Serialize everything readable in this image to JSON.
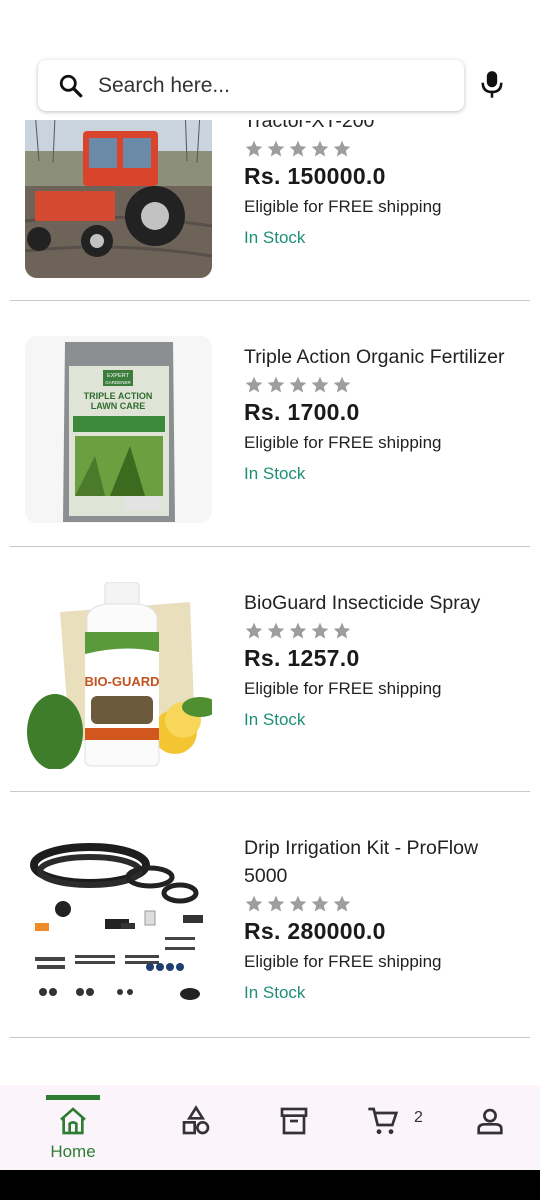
{
  "search": {
    "placeholder": "Search here..."
  },
  "colors": {
    "accent": "#2e7d32",
    "in_stock": "#1e8f74",
    "star": "#9e9e9e"
  },
  "products": [
    {
      "name": "Tractor-XT-200",
      "rating": 0,
      "price": "Rs. 150000.0",
      "shipping": "Eligible for FREE shipping",
      "stock": "In Stock",
      "image": "tractor"
    },
    {
      "name": "Triple Action Organic Fertilizer",
      "rating": 0,
      "price": "Rs. 1700.0",
      "shipping": "Eligible for FREE shipping",
      "stock": "In Stock",
      "image": "fertilizer-bag",
      "image_text": [
        "EXPERT",
        "GARDENER",
        "TRIPLE ACTION",
        "LAWN CARE"
      ]
    },
    {
      "name": "BioGuard Insecticide Spray",
      "rating": 0,
      "price": "Rs. 1257.0",
      "shipping": "Eligible for FREE shipping",
      "stock": "In Stock",
      "image": "insecticide-bottle",
      "image_text": [
        "BIO-GUARD"
      ]
    },
    {
      "name": "Drip Irrigation Kit - ProFlow 5000",
      "rating": 0,
      "price": "Rs. 280000.0",
      "shipping": "Eligible for FREE shipping",
      "stock": "In Stock",
      "image": "drip-kit"
    }
  ],
  "nav": {
    "items": [
      {
        "label": "Home",
        "icon": "home-icon",
        "active": true
      },
      {
        "label": "",
        "icon": "categories-icon"
      },
      {
        "label": "",
        "icon": "archive-icon"
      },
      {
        "label": "",
        "icon": "cart-icon",
        "badge": "2"
      },
      {
        "label": "",
        "icon": "profile-icon"
      }
    ]
  }
}
